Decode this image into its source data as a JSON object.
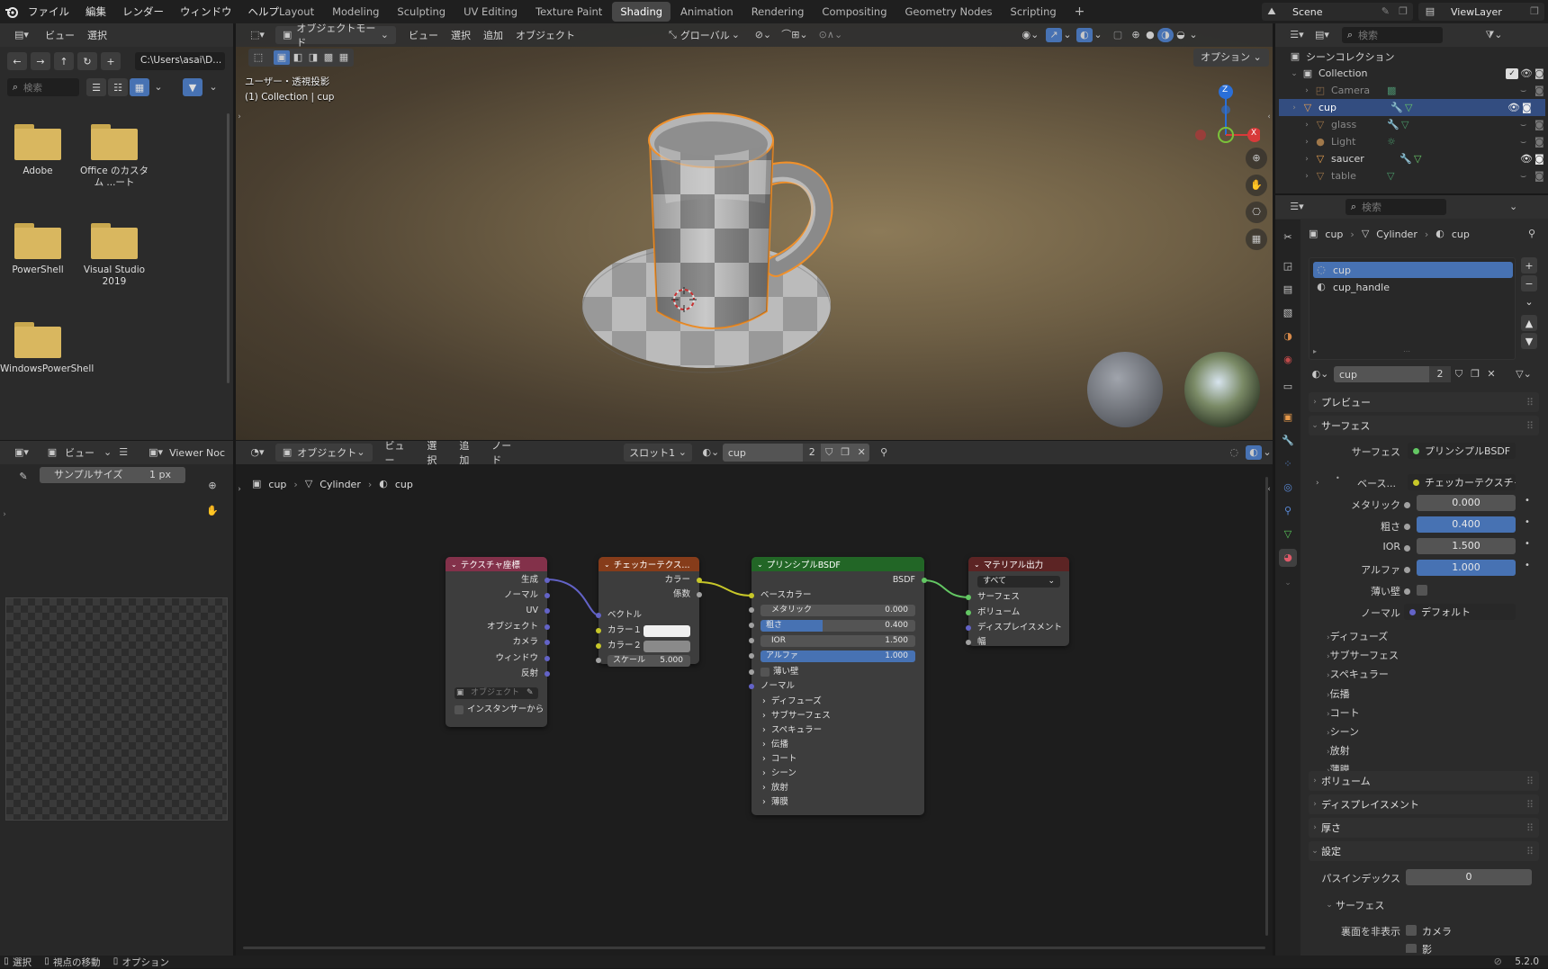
{
  "topbar": {
    "menus": [
      "ファイル",
      "編集",
      "レンダー",
      "ウィンドウ",
      "ヘルプ"
    ],
    "workspaces": [
      "Layout",
      "Modeling",
      "Sculpting",
      "UV Editing",
      "Texture Paint",
      "Shading",
      "Animation",
      "Rendering",
      "Compositing",
      "Geometry Nodes",
      "Scripting"
    ],
    "active_workspace": "Shading",
    "add_tab": "+",
    "scene": "Scene",
    "view_layer": "ViewLayer"
  },
  "filebrowser": {
    "menu_view": "ビュー",
    "menu_select": "選択",
    "path": "C:\\Users\\asai\\D...",
    "search_placeholder": "検索",
    "folders": [
      "Adobe",
      "Office のカスタム ...ート",
      "PowerShell",
      "Visual Studio 2019",
      "WindowsPowerShell"
    ]
  },
  "viewport": {
    "mode": "オブジェクトモード",
    "menus": [
      "ビュー",
      "選択",
      "追加",
      "オブジェクト"
    ],
    "orientation": "グローバル",
    "options": "オプション",
    "info_line1": "ユーザー・透視投影",
    "info_line2": "(1) Collection | cup",
    "gizmo_z": "Z",
    "gizmo_x": "X"
  },
  "image_editor": {
    "menu_view": "ビュー",
    "viewer": "Viewer Noc",
    "sample_label": "サンプルサイズ",
    "sample_value": "1 px"
  },
  "node_editor": {
    "mode": "オブジェクト",
    "menus": [
      "ビュー",
      "選択",
      "追加",
      "ノード"
    ],
    "slot": "スロット1",
    "material": "cup",
    "users": "2",
    "breadcrumb": [
      "cup",
      "Cylinder",
      "cup"
    ],
    "nodes": {
      "texcoord": {
        "title": "テクスチャ座標",
        "outputs": [
          "生成",
          "ノーマル",
          "UV",
          "オブジェクト",
          "カメラ",
          "ウィンドウ",
          "反射"
        ],
        "object_placeholder": "オブジェクト",
        "instancer": "インスタンサーから"
      },
      "checker": {
        "title": "チェッカーテクス...",
        "out_color": "カラー",
        "out_fac": "係数",
        "in_vector": "ベクトル",
        "color1": "カラー１",
        "color2": "カラー２",
        "scale_label": "スケール",
        "scale_value": "5.000"
      },
      "bsdf": {
        "title": "プリンシプルBSDF",
        "out": "BSDF",
        "base_color": "ベースカラー",
        "metallic_label": "メタリック",
        "metallic": "0.000",
        "roughness_label": "粗さ",
        "roughness": "0.400",
        "ior_label": "IOR",
        "ior": "1.500",
        "alpha_label": "アルファ",
        "alpha": "1.000",
        "thin_wall": "薄い壁",
        "normal": "ノーマル",
        "panels": [
          "ディフューズ",
          "サブサーフェス",
          "スペキュラー",
          "伝播",
          "コート",
          "シーン",
          "放射",
          "薄膜"
        ]
      },
      "output": {
        "title": "マテリアル出力",
        "target": "すべて",
        "inputs": [
          "サーフェス",
          "ボリューム",
          "ディスプレイスメント",
          "幅"
        ]
      }
    }
  },
  "outliner": {
    "search_placeholder": "検索",
    "scene_collection": "シーンコレクション",
    "collection": "Collection",
    "items": [
      "Camera",
      "cup",
      "glass",
      "Light",
      "saucer",
      "table"
    ],
    "selected": "cup"
  },
  "properties": {
    "search_placeholder": "検索",
    "breadcrumb": [
      "cup",
      "Cylinder",
      "cup"
    ],
    "slots": [
      "cup",
      "cup_handle"
    ],
    "material_name": "cup",
    "users": "2",
    "sections": {
      "preview": "プレビュー",
      "surface": "サーフェス",
      "volume": "ボリューム",
      "displacement": "ディスプレイスメント",
      "thickness": "厚さ",
      "settings": "設定"
    },
    "surface_label": "サーフェス",
    "surface_value": "プリンシプルBSDF",
    "base_label": "ベース...",
    "base_value": "チェッカーテクスチャ",
    "metallic_label": "メタリック",
    "metallic": "0.000",
    "roughness_label": "粗さ",
    "roughness": "0.400",
    "ior_label": "IOR",
    "ior": "1.500",
    "alpha_label": "アルファ",
    "alpha": "1.000",
    "thin_label": "薄い壁",
    "normal_label": "ノーマル",
    "normal_value": "デフォルト",
    "subpanels": [
      "ディフューズ",
      "サブサーフェス",
      "スペキュラー",
      "伝播",
      "コート",
      "シーン",
      "放射",
      "薄膜"
    ],
    "pass_label": "パスインデックス",
    "pass_value": "0",
    "sub_surface": "サーフェス",
    "backface_label": "裏面を非表示",
    "backface_camera": "カメラ",
    "backface_shadow": "影"
  },
  "statusbar": {
    "select": "選択",
    "move": "視点の移動",
    "options": "オプション",
    "version": "5.2.0"
  },
  "colors": {
    "accent": "#4772b3",
    "selection": "#334d80",
    "outline": "#f0902a",
    "texcoord_header": "#83314a",
    "checker_header": "#863c1a",
    "bsdf_header": "#226626",
    "output_header": "#5c2424"
  }
}
